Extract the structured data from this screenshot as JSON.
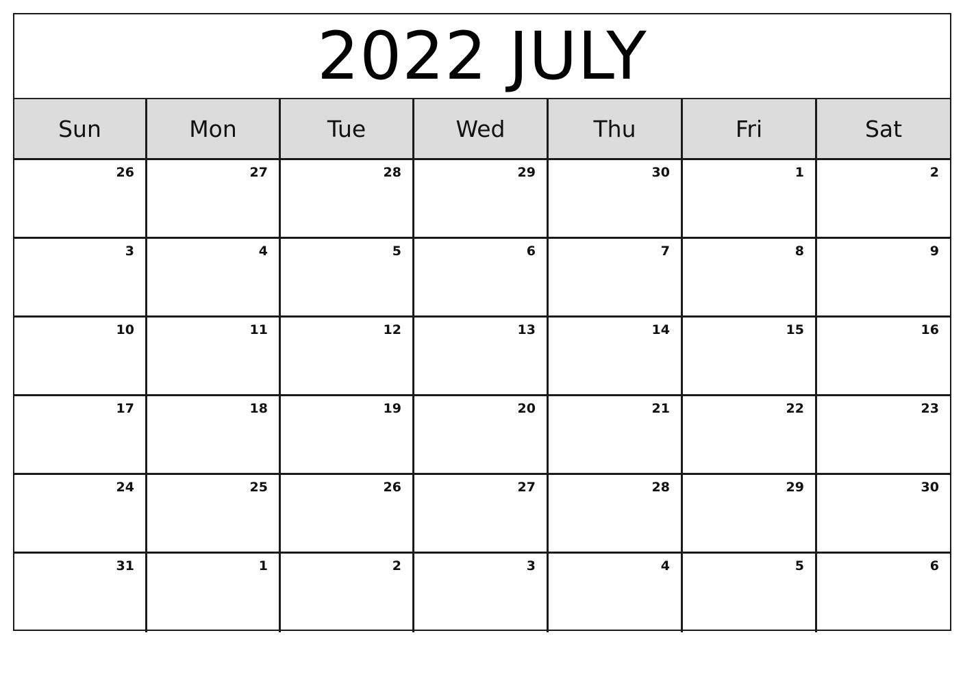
{
  "title": "2022 JULY",
  "weekdays": [
    "Sun",
    "Mon",
    "Tue",
    "Wed",
    "Thu",
    "Fri",
    "Sat"
  ],
  "weeks": [
    [
      "26",
      "27",
      "28",
      "29",
      "30",
      "1",
      "2"
    ],
    [
      "3",
      "4",
      "5",
      "6",
      "7",
      "8",
      "9"
    ],
    [
      "10",
      "11",
      "12",
      "13",
      "14",
      "15",
      "16"
    ],
    [
      "17",
      "18",
      "19",
      "20",
      "21",
      "22",
      "23"
    ],
    [
      "24",
      "25",
      "26",
      "27",
      "28",
      "29",
      "30"
    ],
    [
      "31",
      "1",
      "2",
      "3",
      "4",
      "5",
      "6"
    ]
  ],
  "colors": {
    "header_bg": "#dcdcdc",
    "border": "#1a1a1a"
  }
}
